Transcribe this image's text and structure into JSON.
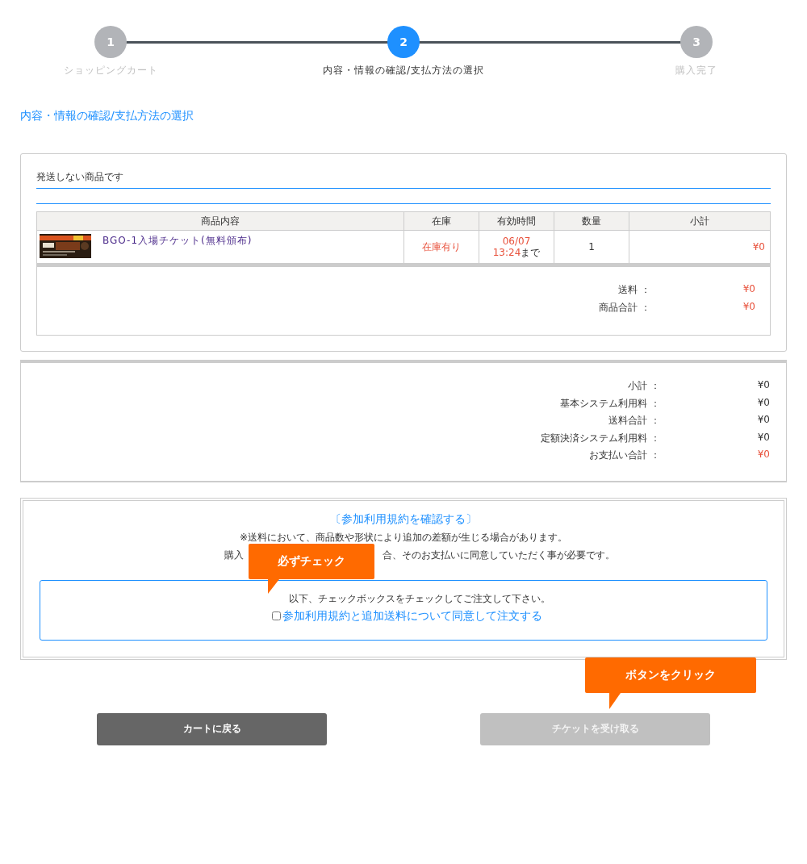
{
  "steps": [
    {
      "number": "1",
      "label": "ショッピングカート",
      "selected": false
    },
    {
      "number": "2",
      "label": "内容・情報の確認/支払方法の選択",
      "selected": true
    },
    {
      "number": "3",
      "label": "購入完了",
      "selected": false
    }
  ],
  "page_title": "内容・情報の確認/支払方法の選択",
  "shipping_section": {
    "heading": "発送しない商品です",
    "columns": [
      "商品内容",
      "在庫",
      "有効時間",
      "数量",
      "小計"
    ],
    "items": [
      {
        "name": "BGO-1入場チケット(無料頒布)",
        "stock": "在庫有り",
        "valid_date": "06/07",
        "valid_time": "13:24",
        "valid_suffix": "まで",
        "quantity": "1",
        "subtotal": "¥0"
      }
    ],
    "totals": [
      {
        "label": "送料 ：",
        "value": "¥0"
      },
      {
        "label": "商品合計 ：",
        "value": "¥0"
      }
    ]
  },
  "summary": [
    {
      "label": "小計 ：",
      "value": "¥0",
      "highlight": false
    },
    {
      "label": "基本システム利用料 ：",
      "value": "¥0",
      "highlight": false
    },
    {
      "label": "送料合計 ：",
      "value": "¥0",
      "highlight": false
    },
    {
      "label": "定額決済システム利用料 ：",
      "value": "¥0",
      "highlight": false
    },
    {
      "label": "お支払い合計 ：",
      "value": "¥0",
      "highlight": true
    }
  ],
  "terms": {
    "link": "〔参加利用規約を確認する〕",
    "note": "※送料において、商品数や形状により追加の差額が生じる場合があります。",
    "note_partial": [
      "購入",
      "合、そのお支払いに同意していただく事が必要です。"
    ],
    "callout": "必ずチェック",
    "instruction": "以下、チェックボックスをチェックしてご注文して下さい。",
    "agree": {
      "label": "参加利用規約と追加送料について同意して注文する",
      "checked": false
    }
  },
  "button_callout": "ボタンをクリック",
  "buttons": [
    {
      "label": "カートに戻る",
      "disabled": false
    },
    {
      "label": "チケットを受け取る",
      "disabled": true
    }
  ]
}
